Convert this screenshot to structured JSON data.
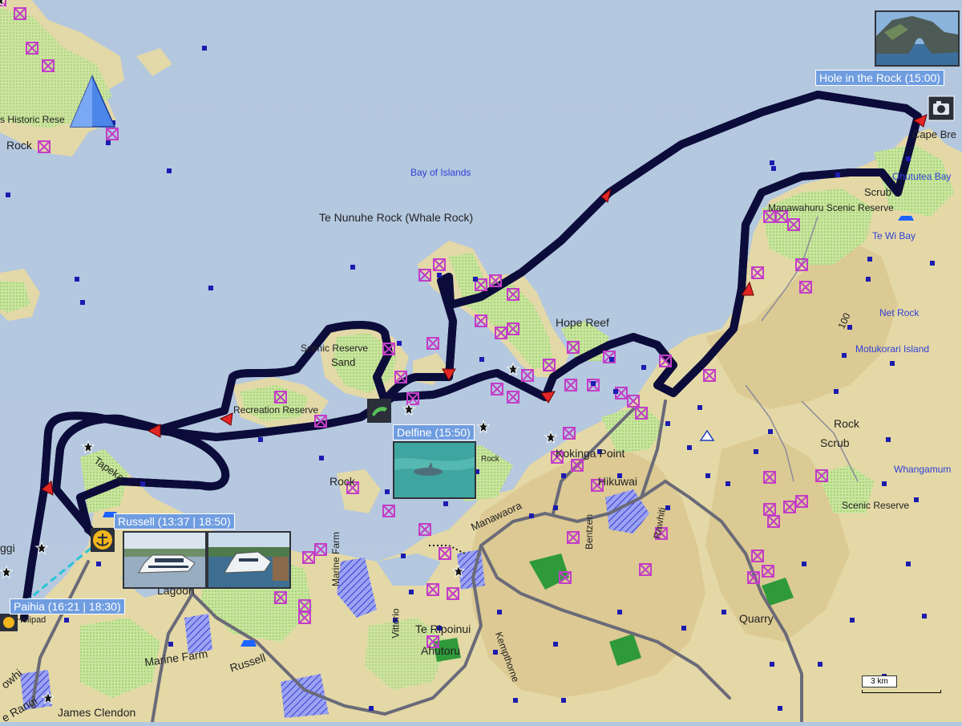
{
  "map": {
    "labels": {
      "bay_of_islands": "Bay of Islands",
      "whale_rock": "Te Nunuhe Rock (Whale Rock)",
      "hope_reef": "Hope Reef",
      "scenic_reserve": "Scenic Reserve",
      "sand": "Sand",
      "recreation_reserve": "Recreation Reserve",
      "rock": "Rock",
      "rock_small": "Rock",
      "rock_east": "Rock",
      "scrub": "Scrub",
      "scrub_east": "Scrub",
      "historic_reserve": "s Historic Rese",
      "rock_nw": "Rock",
      "cape_brett": "Cape Bre",
      "ohututea_bay": "Ohututea Bay",
      "manawahuru": "Manawahuru Scenic Reserve",
      "te_wi_bay": "Te Wi Bay",
      "net_rock": "Net Rock",
      "motukorari": "Motukorari Island",
      "contour_100": "100",
      "kokinga_point": "Kokinga Point",
      "hikuwai": "Hikuwai",
      "manawaora": "Manawaora",
      "whangamumu": "Whangamum",
      "scenic_reserve_east": "Scenic Reserve",
      "quarry": "Quarry",
      "te_ripoinui": "Te Ripoinui",
      "ahutoru": "Ahutoru",
      "lagoon": "Lagoon",
      "marine_farm": "Marine Farm",
      "marine_farm_v": "Marine Farm",
      "russell_road": "Russell",
      "james_clendon": "James Clendon",
      "helipad": "Helipad",
      "tapeka": "Tapeka",
      "paihia_left": "ggi",
      "vittorio": "Vittorio",
      "kempthorne": "Kempthorne",
      "bentzen": "Bentzen",
      "rawhiti": "Rawhiti",
      "te_rangi": "e Rangi",
      "rowhi": "owhi"
    },
    "waypoints": {
      "hole_in_rock": "Hole in the Rock (15:00)",
      "delfine": "Delfine (15:50)",
      "russell": "Russell (13:37 | 18:50)",
      "paihia": "Paihia (16:21 | 18:30)"
    },
    "scale": "3 km",
    "colors": {
      "sea": "#b3c7df",
      "land": "#e6dcae",
      "forest": "#b9dc8c",
      "route": "#3b3bd9",
      "route_outline": "#0c0c3a",
      "waypoint_label_bg": "#6f9de0",
      "cliff_marker": "#c23fc6",
      "point_marker": "#1c1cb0"
    },
    "icons": [
      "north-arrow-icon",
      "camera-icon",
      "anchor-icon",
      "dolphin-icon",
      "star-icon",
      "boat-ramp-icon"
    ]
  }
}
